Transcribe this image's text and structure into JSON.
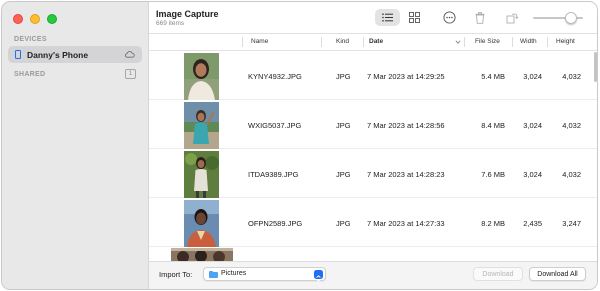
{
  "sidebar": {
    "devices_header": "DEVICES",
    "device_name": "Danny's Phone",
    "shared_header": "SHARED",
    "shared_count": "1"
  },
  "toolbar": {
    "title": "Image Capture",
    "subtitle": "669 items",
    "icons": [
      "list-view-icon",
      "grid-view-icon",
      "more-icon",
      "trash-icon",
      "rotate-icon"
    ],
    "thumbnail_size_fraction": 0.85
  },
  "table": {
    "columns": {
      "name": "Name",
      "kind": "Kind",
      "date": "Date",
      "size": "File Size",
      "width": "Width",
      "height": "Height"
    },
    "rows": [
      {
        "name": "KYNY4932.JPG",
        "kind": "JPG",
        "date": "7 Mar 2023 at 14:29:25",
        "size": "5.4 MB",
        "width": "3,024",
        "height": "4,032"
      },
      {
        "name": "WXIG5037.JPG",
        "kind": "JPG",
        "date": "7 Mar 2023 at 14:28:56",
        "size": "8.4 MB",
        "width": "3,024",
        "height": "4,032"
      },
      {
        "name": "ITDA9389.JPG",
        "kind": "JPG",
        "date": "7 Mar 2023 at 14:28:23",
        "size": "7.6 MB",
        "width": "3,024",
        "height": "4,032"
      },
      {
        "name": "OFPN2589.JPG",
        "kind": "JPG",
        "date": "7 Mar 2023 at 14:27:33",
        "size": "8.2 MB",
        "width": "2,435",
        "height": "3,247"
      }
    ]
  },
  "footer": {
    "import_label": "Import To:",
    "destination": "Pictures",
    "download_label": "Download",
    "download_all_label": "Download All"
  },
  "colors": {
    "accent": "#1e6ff1",
    "sidebar_bg": "#e9e8e8",
    "selected_row": "#d4d4d6"
  }
}
